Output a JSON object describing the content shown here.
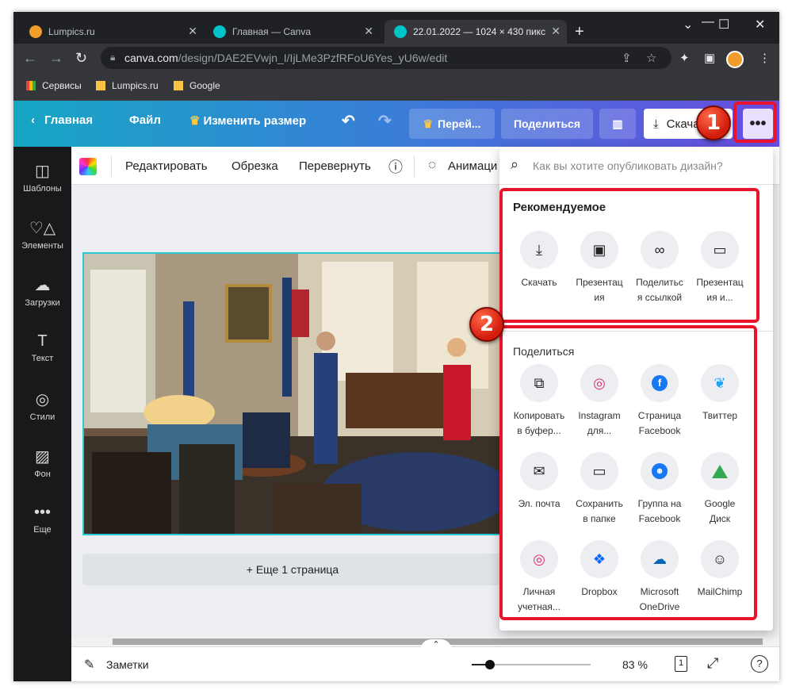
{
  "browser": {
    "tabs": [
      {
        "title": "Lumpics.ru",
        "favicon_color": "#f29d2b"
      },
      {
        "title": "Главная — Canva",
        "favicon_color": "#00c4cc"
      },
      {
        "title": "22.01.2022 — 1024 × 430 пикс",
        "favicon_color": "#00c4cc"
      }
    ],
    "url_host": "canva.com",
    "url_path": "/design/DAE2EVwjn_I/IjLMe3PzfRFoU6Yes_yU6w/edit",
    "bookmarks": [
      "Сервисы",
      "Lumpics.ru",
      "Google"
    ]
  },
  "header": {
    "home": "Главная",
    "file": "Файл",
    "resize": "Изменить размер",
    "transfer": "Перей...",
    "share": "Поделиться",
    "download": "Скачать",
    "more": "•••"
  },
  "sidebar": {
    "items": [
      "Шаблоны",
      "Элементы",
      "Загрузки",
      "Текст",
      "Стили",
      "Фон",
      "Еще"
    ]
  },
  "subbar": {
    "edit": "Редактировать",
    "crop": "Обрезка",
    "flip": "Перевернуть",
    "animate": "Анимаци"
  },
  "canvas": {
    "add_page": "+ Еще 1 страница"
  },
  "bottombar": {
    "notes": "Заметки",
    "zoom": "83 %",
    "page": "1"
  },
  "dropdown": {
    "search_placeholder": "Как вы хотите опубликовать дизайн?",
    "recommended_title": "Рекомендуемое",
    "recommended": [
      {
        "label": "Скачать",
        "icon": "download-icon"
      },
      {
        "label": "Презентация",
        "icon": "present-icon"
      },
      {
        "label": "Поделиться ссылкой",
        "icon": "link-icon"
      },
      {
        "label": "Презентация и...",
        "icon": "record-icon"
      }
    ],
    "share_title": "Поделиться",
    "share": [
      {
        "label": "Копировать в буфер...",
        "icon": "copy-icon"
      },
      {
        "label": "Instagram для...",
        "icon": "instagram-icon"
      },
      {
        "label": "Страница Facebook",
        "icon": "facebook-icon"
      },
      {
        "label": "Твиттер",
        "icon": "twitter-icon"
      },
      {
        "label": "Эл. почта",
        "icon": "mail-icon"
      },
      {
        "label": "Сохранить в папке",
        "icon": "folder-icon"
      },
      {
        "label": "Группа на Facebook",
        "icon": "fb-group-icon"
      },
      {
        "label": "Google Диск",
        "icon": "gdrive-icon"
      },
      {
        "label": "Личная учетная...",
        "icon": "instagram-icon"
      },
      {
        "label": "Dropbox",
        "icon": "dropbox-icon"
      },
      {
        "label": "Microsoft OneDrive",
        "icon": "onedrive-icon"
      },
      {
        "label": "MailChimp",
        "icon": "mailchimp-icon"
      }
    ]
  },
  "annotations": {
    "badge1": "1",
    "badge2": "2"
  },
  "colors": {
    "accent_red": "#e8142b",
    "canva_gradient_start": "#16a6c4",
    "canva_gradient_end": "#6a4be0"
  }
}
